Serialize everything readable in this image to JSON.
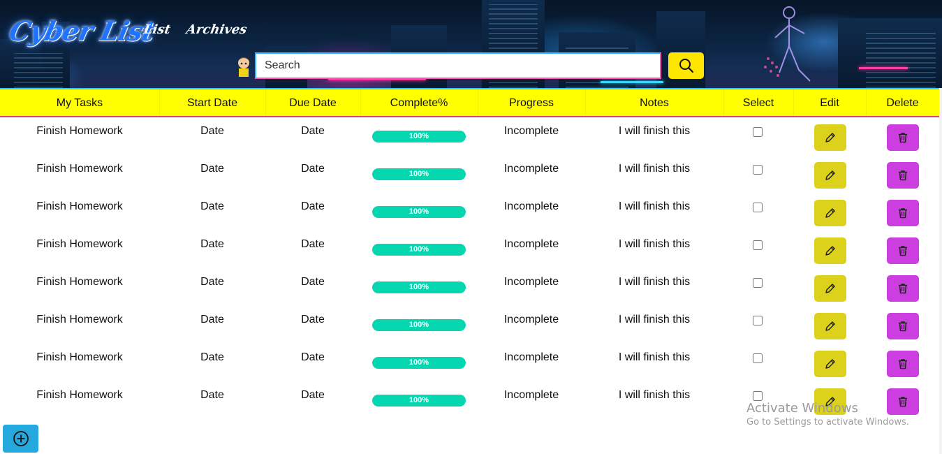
{
  "brand": {
    "logo_text": "Cyber List"
  },
  "nav": {
    "items": [
      {
        "label": "List"
      },
      {
        "label": "Archives"
      }
    ]
  },
  "search": {
    "placeholder": "Search",
    "value": ""
  },
  "table": {
    "columns": [
      "My Tasks",
      "Start Date",
      "Due Date",
      "Complete%",
      "Progress",
      "Notes",
      "Select",
      "Edit",
      "Delete"
    ],
    "rows": [
      {
        "task": "Finish Homework",
        "start": "Date",
        "due": "Date",
        "complete": "100%",
        "complete_fraction": 1.0,
        "progress": "Incomplete",
        "notes": "I will finish this",
        "selected": false
      },
      {
        "task": "Finish Homework",
        "start": "Date",
        "due": "Date",
        "complete": "100%",
        "complete_fraction": 1.0,
        "progress": "Incomplete",
        "notes": "I will finish this",
        "selected": false
      },
      {
        "task": "Finish Homework",
        "start": "Date",
        "due": "Date",
        "complete": "100%",
        "complete_fraction": 1.0,
        "progress": "Incomplete",
        "notes": "I will finish this",
        "selected": false
      },
      {
        "task": "Finish Homework",
        "start": "Date",
        "due": "Date",
        "complete": "100%",
        "complete_fraction": 1.0,
        "progress": "Incomplete",
        "notes": "I will finish this",
        "selected": false
      },
      {
        "task": "Finish Homework",
        "start": "Date",
        "due": "Date",
        "complete": "100%",
        "complete_fraction": 1.0,
        "progress": "Incomplete",
        "notes": "I will finish this",
        "selected": false
      },
      {
        "task": "Finish Homework",
        "start": "Date",
        "due": "Date",
        "complete": "100%",
        "complete_fraction": 1.0,
        "progress": "Incomplete",
        "notes": "I will finish this",
        "selected": false
      },
      {
        "task": "Finish Homework",
        "start": "Date",
        "due": "Date",
        "complete": "100%",
        "complete_fraction": 1.0,
        "progress": "Incomplete",
        "notes": "I will finish this",
        "selected": false
      },
      {
        "task": "Finish Homework",
        "start": "Date",
        "due": "Date",
        "complete": "100%",
        "complete_fraction": 1.0,
        "progress": "Incomplete",
        "notes": "I will finish this",
        "selected": false
      }
    ]
  },
  "icons": {
    "search": "search-icon",
    "edit": "pencil-icon",
    "delete": "trash-icon",
    "add": "plus-circle-icon"
  },
  "colors": {
    "header_bar": "#ffff00",
    "search_button": "#ffe600",
    "progress_fill": "#04d6b0",
    "edit_button": "#ddd21b",
    "delete_button": "#cc3ee0",
    "add_button": "#24a8dd",
    "logo": "#1e73ff"
  },
  "watermark": {
    "title": "Activate Windows",
    "subtitle": "Go to Settings to activate Windows."
  }
}
